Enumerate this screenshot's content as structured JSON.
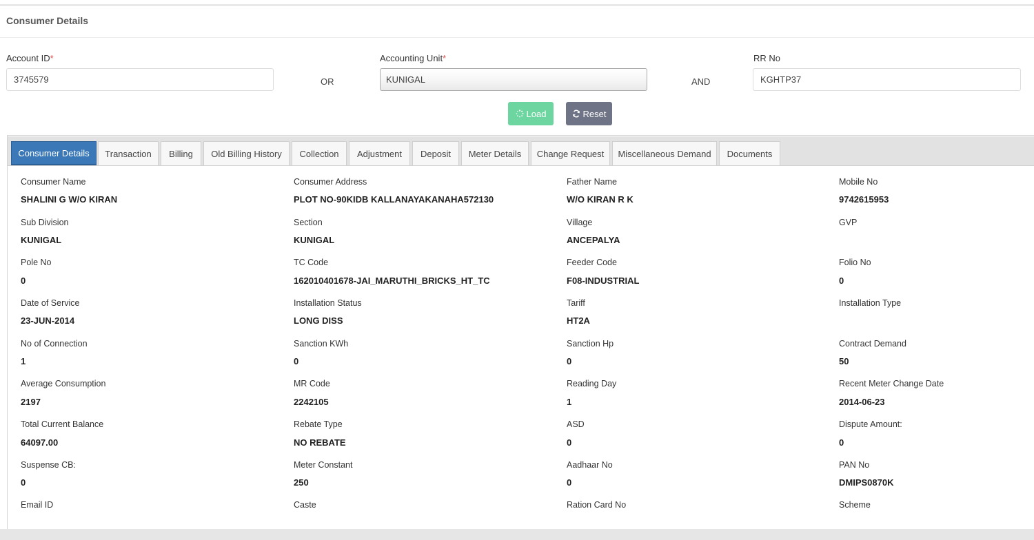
{
  "page": {
    "title": "Consumer Details"
  },
  "search": {
    "account_id_label": "Account ID",
    "account_id_value": "3745579",
    "or_text": "OR",
    "accounting_unit_label": "Accounting Unit",
    "accounting_unit_value": "KUNIGAL",
    "and_text": "AND",
    "rr_no_label": "RR No",
    "rr_no_value": "KGHTP37",
    "required_mark": "*"
  },
  "buttons": {
    "load_label": "Load",
    "reset_label": "Reset"
  },
  "colors": {
    "load": "#6dd6a0",
    "reset": "#6e7386",
    "active_tab": "#3a78b8",
    "required": "#d9534f"
  },
  "tabs": [
    {
      "label": "Consumer Details",
      "active": true
    },
    {
      "label": "Transaction"
    },
    {
      "label": "Billing"
    },
    {
      "label": "Old Billing History"
    },
    {
      "label": "Collection"
    },
    {
      "label": "Adjustment"
    },
    {
      "label": "Deposit"
    },
    {
      "label": "Meter Details"
    },
    {
      "label": "Change Request"
    },
    {
      "label": "Miscellaneous Demand"
    },
    {
      "label": "Documents"
    }
  ],
  "details": [
    {
      "label": "Consumer Name",
      "value": "SHALINI G W/O KIRAN"
    },
    {
      "label": "Consumer Address",
      "value": "PLOT NO-90KIDB KALLANAYAKANAHA572130"
    },
    {
      "label": "Father Name",
      "value": "W/O KIRAN R K"
    },
    {
      "label": "Mobile No",
      "value": "9742615953"
    },
    {
      "label": "Sub Division",
      "value": "KUNIGAL"
    },
    {
      "label": "Section",
      "value": "KUNIGAL"
    },
    {
      "label": "Village",
      "value": "ANCEPALYA"
    },
    {
      "label": "GVP",
      "value": ""
    },
    {
      "label": "Pole No",
      "value": "0"
    },
    {
      "label": "TC Code",
      "value": "162010401678-JAI_MARUTHI_BRICKS_HT_TC"
    },
    {
      "label": "Feeder Code",
      "value": "F08-INDUSTRIAL"
    },
    {
      "label": "Folio No",
      "value": "0"
    },
    {
      "label": "Date of Service",
      "value": "23-JUN-2014"
    },
    {
      "label": "Installation Status",
      "value": "LONG DISS"
    },
    {
      "label": "Tariff",
      "value": "HT2A"
    },
    {
      "label": "Installation Type",
      "value": ""
    },
    {
      "label": "No of Connection",
      "value": "1"
    },
    {
      "label": "Sanction KWh",
      "value": "0"
    },
    {
      "label": "Sanction Hp",
      "value": "0"
    },
    {
      "label": "Contract Demand",
      "value": "50"
    },
    {
      "label": "Average Consumption",
      "value": "2197"
    },
    {
      "label": "MR Code",
      "value": "2242105"
    },
    {
      "label": "Reading Day",
      "value": "1"
    },
    {
      "label": "Recent Meter Change Date",
      "value": "2014-06-23"
    },
    {
      "label": "Total Current Balance",
      "value": "64097.00"
    },
    {
      "label": "Rebate Type",
      "value": "NO REBATE"
    },
    {
      "label": "ASD",
      "value": "0"
    },
    {
      "label": "Dispute Amount:",
      "value": "0"
    },
    {
      "label": "Suspense CB:",
      "value": "0"
    },
    {
      "label": "Meter Constant",
      "value": "250"
    },
    {
      "label": "Aadhaar No",
      "value": "0"
    },
    {
      "label": "PAN No",
      "value": "DMIPS0870K"
    },
    {
      "label": "Email ID",
      "value": ""
    },
    {
      "label": "Caste",
      "value": ""
    },
    {
      "label": "Ration Card No",
      "value": ""
    },
    {
      "label": "Scheme",
      "value": ""
    }
  ]
}
